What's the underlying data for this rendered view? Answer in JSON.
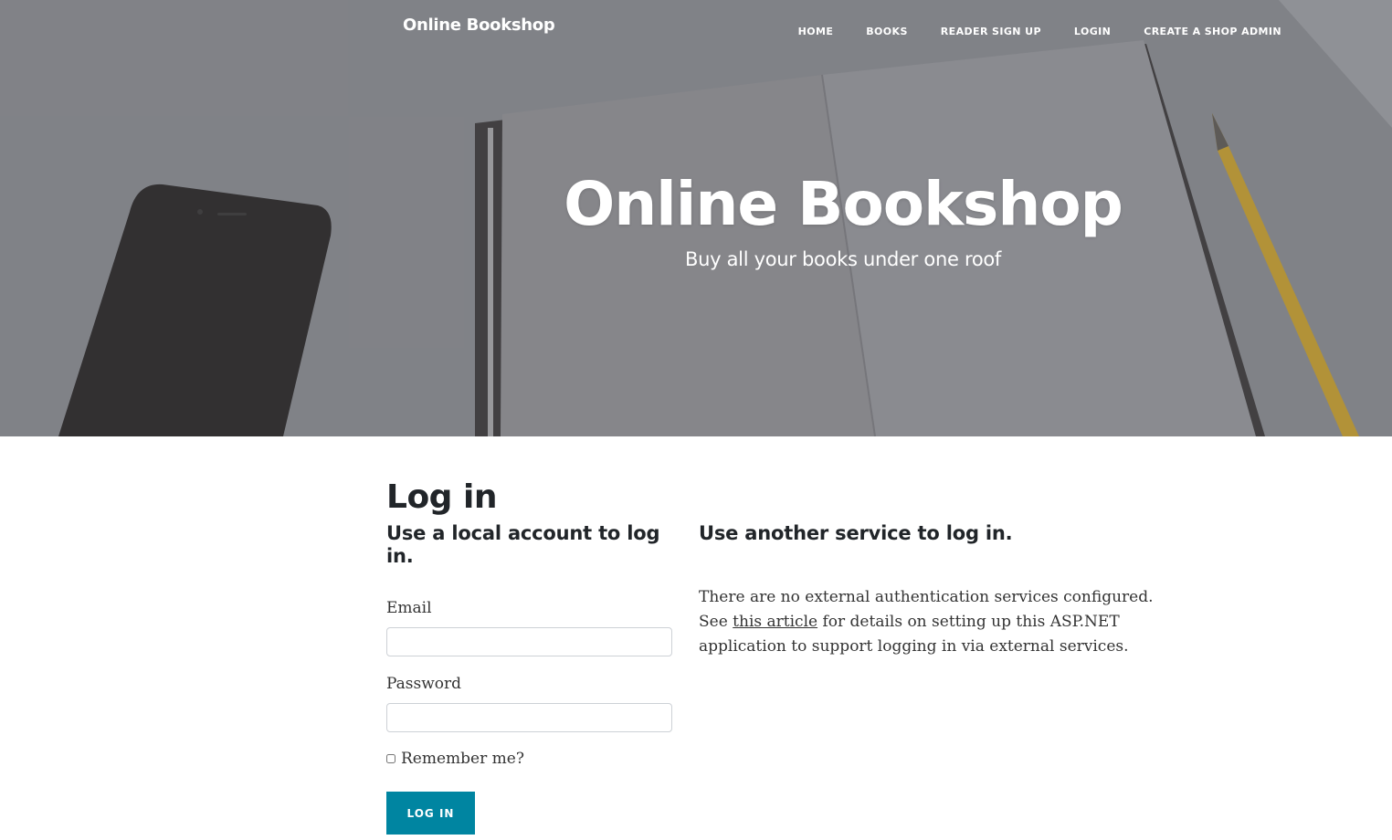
{
  "navbar": {
    "brand": "Online Bookshop",
    "links": [
      "HOME",
      "BOOKS",
      "READER SIGN UP",
      "LOGIN",
      "CREATE A SHOP ADMIN"
    ]
  },
  "hero": {
    "title": "Online Bookshop",
    "subtitle": "Buy all your books under one roof"
  },
  "login": {
    "title": "Log in",
    "local_heading": "Use a local account to log in.",
    "email_label": "Email",
    "email_value": "",
    "password_label": "Password",
    "password_value": "",
    "remember_label": "Remember me?",
    "submit_label": "LOG IN"
  },
  "external": {
    "heading": "Use another service to log in.",
    "text_before": "There are no external authentication services configured. See ",
    "link_text": "this article",
    "text_after": " for details on setting up this ASP.NET application to support logging in via external services."
  },
  "colors": {
    "button": "#0085a1",
    "text": "#212529"
  }
}
